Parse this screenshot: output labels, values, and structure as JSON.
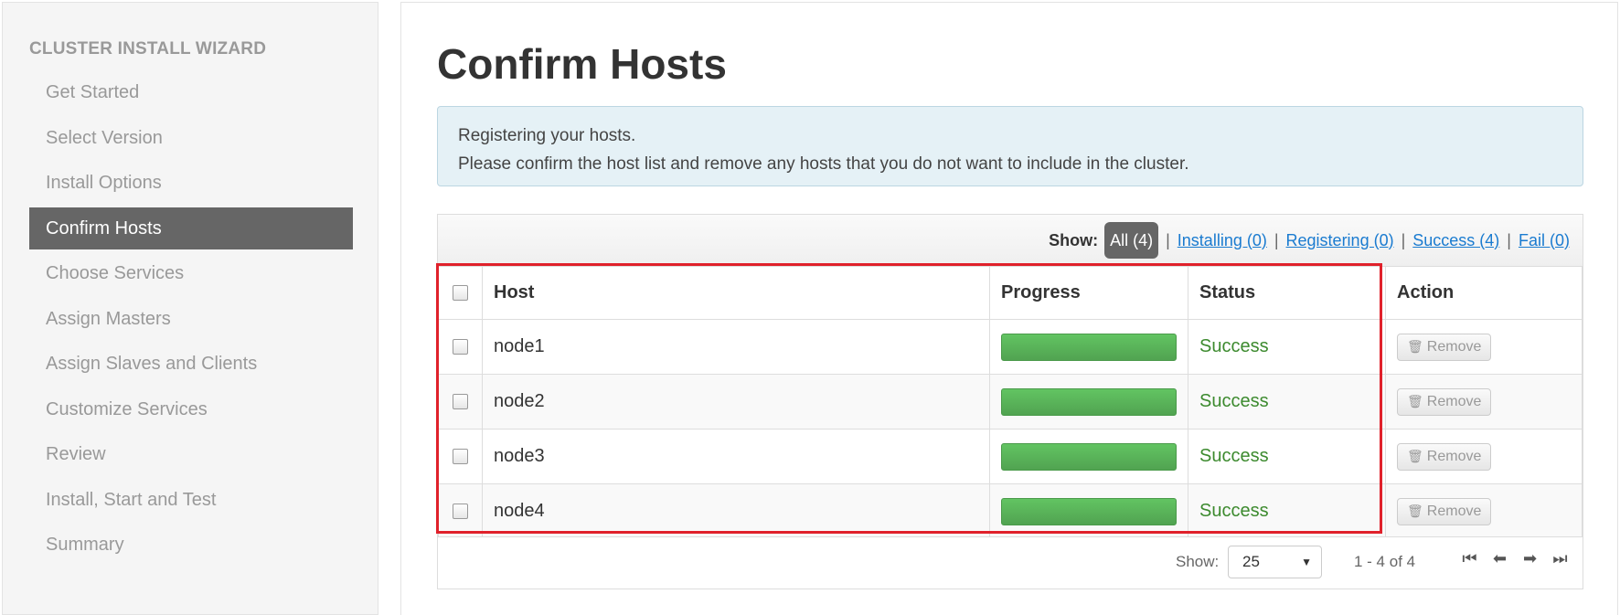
{
  "sidebar": {
    "title": "CLUSTER INSTALL WIZARD",
    "items": [
      {
        "label": "Get Started"
      },
      {
        "label": "Select Version"
      },
      {
        "label": "Install Options"
      },
      {
        "label": "Confirm Hosts",
        "active": true
      },
      {
        "label": "Choose Services"
      },
      {
        "label": "Assign Masters"
      },
      {
        "label": "Assign Slaves and Clients"
      },
      {
        "label": "Customize Services"
      },
      {
        "label": "Review"
      },
      {
        "label": "Install, Start and Test"
      },
      {
        "label": "Summary"
      }
    ]
  },
  "main": {
    "title": "Confirm Hosts",
    "alert": {
      "line1": "Registering your hosts.",
      "line2": "Please confirm the host list and remove any hosts that you do not want to include in the cluster."
    },
    "filters": {
      "show_label": "Show:",
      "all": "All (4)",
      "installing": "Installing (0)",
      "registering": "Registering (0)",
      "success": "Success (4)",
      "fail": "Fail (0)",
      "separator": "|"
    },
    "table": {
      "headers": {
        "host": "Host",
        "progress": "Progress",
        "status": "Status",
        "action": "Action"
      },
      "rows": [
        {
          "host": "node1",
          "progress": 1.0,
          "status": "Success",
          "action": "Remove"
        },
        {
          "host": "node2",
          "progress": 1.0,
          "status": "Success",
          "action": "Remove"
        },
        {
          "host": "node3",
          "progress": 1.0,
          "status": "Success",
          "action": "Remove"
        },
        {
          "host": "node4",
          "progress": 1.0,
          "status": "Success",
          "action": "Remove"
        }
      ]
    },
    "footer": {
      "show_label": "Show:",
      "page_size": "25",
      "range": "1 - 4 of 4"
    }
  },
  "colors": {
    "active_nav": "#666666",
    "success_text": "#3c8a2e",
    "progress_bar": "#5cb85c",
    "highlight_border": "#e0212b",
    "link": "#1a7bd0"
  },
  "icons": [
    "trash-icon",
    "first-page-icon",
    "prev-page-icon",
    "next-page-icon",
    "last-page-icon",
    "caret-down-icon"
  ]
}
